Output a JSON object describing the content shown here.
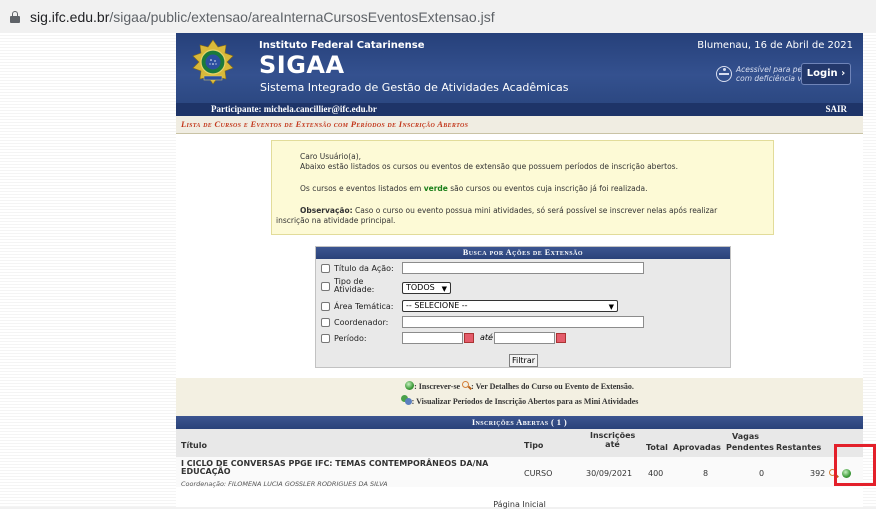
{
  "browser": {
    "url_host": "sig.ifc.edu.br",
    "url_path": "/sigaa/public/extensao/areaInternaCursosEventosExtensao.jsf"
  },
  "header": {
    "institution": "Instituto Federal Catarinense",
    "date": "Blumenau, 16 de Abril de 2021",
    "app_name": "SIGAA",
    "app_subtitle": "Sistema Integrado de Gestão de Atividades Acadêmicas",
    "accessibility_line1": "Acessível para pessoas",
    "accessibility_line2": "com deficiência visual",
    "login_label": "Login  ›"
  },
  "userbar": {
    "participant": "Participante: michela.cancillier@ifc.edu.br",
    "logout": "SAIR"
  },
  "page_title": "Lista de Cursos e Eventos de Extensão com Períodos de Inscrição Abertos",
  "notice": {
    "greeting": "Caro Usuário(a),",
    "line1": "Abaixo estão listados os cursos ou eventos de extensão que possuem períodos de inscrição abertos.",
    "line2_a": "Os cursos e eventos listados em ",
    "line2_verde": "verde",
    "line2_b": " são cursos ou eventos cuja inscrição já foi realizada.",
    "obs_label": "Observação:",
    "obs_text": " Caso o curso ou evento possua mini atividades, só será possível se inscrever nelas após realizar",
    "obs_text2": "inscrição na atividade principal."
  },
  "search": {
    "header": "Busca por Ações de Extensão",
    "titulo_label": "Título da Ação:",
    "titulo_value": "",
    "tipo_label_1": "Tipo de",
    "tipo_label_2": "Atividade:",
    "tipo_value": "TODOS",
    "area_label": "Área Temática:",
    "area_value": "-- SELECIONE --",
    "coord_label": "Coordenador:",
    "coord_value": "",
    "periodo_label": "Período:",
    "ate_label": "até",
    "periodo_from": "",
    "periodo_to": "",
    "filter_button": "Filtrar"
  },
  "legend": {
    "inscrever": ": Inscrever-se",
    "detalhes": ": Ver Detalhes do Curso ou Evento de Extensão.",
    "mini": ": Visualizar Períodos de Inscrição Abertos para as Mini Atividades"
  },
  "table": {
    "header": "Inscrições Abertas ( 1 )",
    "columns": {
      "titulo": "Título",
      "tipo": "Tipo",
      "inscricoes_1": "Inscrições",
      "inscricoes_2": "até",
      "vagas": "Vagas",
      "total": "Total",
      "aprovadas": "Aprovadas",
      "pendentes": "Pendentes",
      "restantes": "Restantes"
    },
    "rows": [
      {
        "titulo_1": "I CICLO DE CONVERSAS PPGE IFC: TEMAS CONTEMPORÂNEOS DA/NA",
        "titulo_2": "EDUCAÇÃO",
        "coordenacao": "Coordenação: FILOMENA LUCIA GOSSLER RODRIGUES DA SILVA",
        "tipo": "CURSO",
        "inscricoes_ate": "30/09/2021",
        "total": "400",
        "aprovadas": "8",
        "pendentes": "0",
        "restantes": "392"
      }
    ]
  },
  "footer": "Página Inicial",
  "colors": {
    "header_blue": "#2c4882",
    "title_red": "#c2361a",
    "highlight_red": "#e3202a",
    "verde": "#1a7f1a"
  }
}
